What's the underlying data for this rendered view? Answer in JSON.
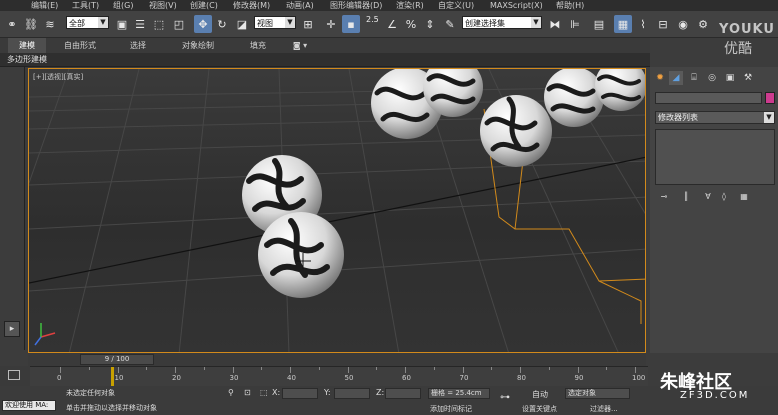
{
  "menu": [
    "编辑(E)",
    "工具(T)",
    "组(G)",
    "视图(V)",
    "创建(C)",
    "修改器(M)",
    "动画(A)",
    "图形编辑器(D)",
    "渲染(R)",
    "自定义(U)",
    "MAXScript(X)",
    "帮助(H)"
  ],
  "toolbar": {
    "selection_filter": "全部",
    "ref_coord": "视图",
    "snap_value": "2.5",
    "named_selection": "创建选择集"
  },
  "ribbon": {
    "tabs": [
      "建模",
      "自由形式",
      "选择",
      "对象绘制",
      "填充"
    ],
    "active_tab": "建模",
    "subtitle": "多边形建模"
  },
  "viewport": {
    "label": "[+][透视][真实]"
  },
  "command_panel": {
    "modifier_list": "修改器列表"
  },
  "timeline": {
    "frame_display": "9 / 100",
    "current_frame": 9,
    "total_frames": 100,
    "ticks": [
      "0",
      "10",
      "20",
      "30",
      "40",
      "50",
      "60",
      "70",
      "80",
      "90",
      "100"
    ]
  },
  "status": {
    "welcome": "欢迎使用 MA:",
    "selection_info": "未选定任何对象",
    "prompt": "单击并拖动以选择并移动对象",
    "x_label": "X:",
    "y_label": "Y:",
    "z_label": "Z:",
    "grid": "栅格 = 25.4cm",
    "add_time_tag": "添加时间标记",
    "auto_key": "自动",
    "set_key": "设置关键点",
    "selected_objects": "选定对象",
    "filters": "过滤器..."
  },
  "watermarks": {
    "youku": "YOUKU",
    "youku_cn": "优酷",
    "zf_site": "朱峰社区",
    "zf_url": "ZF3D.COM"
  },
  "colors": {
    "viewport_border": "#d28a1b",
    "active_tool": "#5a7fb0",
    "object_color": "#cd3b8e",
    "playhead": "#c8a000"
  }
}
